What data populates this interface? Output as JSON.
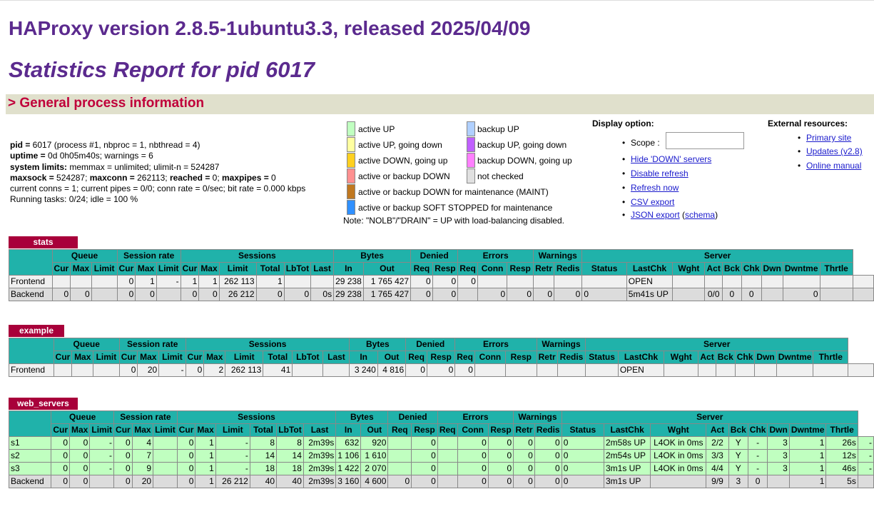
{
  "header": {
    "version_title": "HAProxy version 2.8.5-1ubuntu3.3, released 2025/04/09",
    "report_title": "Statistics Report for pid 6017",
    "section_title": "> General process information"
  },
  "process_info": {
    "line1_k": "pid =",
    "line1_v": " 6017 (process #1, nbproc = 1, nbthread = 4)",
    "line2_k": "uptime =",
    "line2_v": " 0d 0h05m40s; warnings = 6",
    "line3_k": "system limits:",
    "line3_v": " memmax = unlimited; ulimit-n = 524287",
    "line4_k1": "maxsock =",
    "line4_v1": " 524287; ",
    "line4_k2": "maxconn =",
    "line4_v2": " 262113; ",
    "line4_k3": "reached =",
    "line4_v3": " 0; ",
    "line4_k4": "maxpipes =",
    "line4_v4": " 0",
    "line5": "current conns = 1; current pipes = 0/0; conn rate = 0/sec; bit rate = 0.000 kbps",
    "line6": "Running tasks: 0/24; idle = 100 %"
  },
  "legend": {
    "active_up": "active UP",
    "active_up_going_down": "active UP, going down",
    "active_down_going_up": "active DOWN, going up",
    "active_or_backup_down": "active or backup DOWN",
    "maint": "active or backup DOWN for maintenance (MAINT)",
    "soft_stopped": "active or backup SOFT STOPPED for maintenance",
    "backup_up": "backup UP",
    "backup_up_going_down": "backup UP, going down",
    "backup_down_going_up": "backup DOWN, going up",
    "not_checked": "not checked",
    "note": "Note: \"NOLB\"/\"DRAIN\" = UP with load-balancing disabled.",
    "colors": {
      "active_up": "#c0ffc0",
      "active_up_going_down": "#ffffa0",
      "active_down_going_up": "#ffd020",
      "active_or_backup_down": "#ff9090",
      "maint": "#c07820",
      "soft_stopped": "#3090ff",
      "backup_up": "#b0d0ff",
      "backup_up_going_down": "#c060ff",
      "backup_down_going_up": "#ff80ff",
      "not_checked": "#e0e0e0"
    }
  },
  "display_option": {
    "title": "Display option:",
    "scope_label": "Scope :",
    "hide_down": "Hide 'DOWN' servers",
    "disable_refresh": "Disable refresh",
    "refresh_now": "Refresh now",
    "csv_export": "CSV export",
    "json_export": "JSON export",
    "schema_open": " (",
    "schema": "schema",
    "schema_close": ")"
  },
  "external": {
    "title": "External resources:",
    "primary_site": "Primary site",
    "updates": "Updates (v2.8)",
    "online_manual": "Online manual"
  },
  "headers": {
    "queue": "Queue",
    "session_rate": "Session rate",
    "sessions": "Sessions",
    "bytes": "Bytes",
    "denied": "Denied",
    "errors": "Errors",
    "warnings": "Warnings",
    "server": "Server",
    "cur": "Cur",
    "max": "Max",
    "limit": "Limit",
    "total": "Total",
    "lbtot": "LbTot",
    "last": "Last",
    "in": "In",
    "out": "Out",
    "req": "Req",
    "resp": "Resp",
    "conn": "Conn",
    "retr": "Retr",
    "redis": "Redis",
    "status": "Status",
    "lastchk": "LastChk",
    "wght": "Wght",
    "act": "Act",
    "bck": "Bck",
    "chk": "Chk",
    "dwn": "Dwn",
    "dwntme": "Dwntme",
    "thrtle": "Thrtle"
  },
  "tables": [
    {
      "name": "stats",
      "rows": [
        [
          "Frontend",
          "",
          "",
          "",
          "0",
          "1",
          "-",
          "1",
          "1",
          "262 113",
          "1",
          "",
          "",
          "29 238",
          "1 765 427",
          "0",
          "0",
          "0",
          "",
          "",
          "",
          "",
          "",
          "OPEN",
          "",
          "",
          "",
          "",
          "",
          "",
          "",
          ""
        ],
        [
          "Backend",
          "0",
          "0",
          "",
          "0",
          "0",
          "",
          "0",
          "0",
          "26 212",
          "0",
          "0",
          "0s",
          "29 238",
          "1 765 427",
          "0",
          "0",
          "",
          "0",
          "0",
          "0",
          "0",
          "0",
          "5m41s UP",
          "",
          "0/0",
          "0",
          "0",
          "",
          "0",
          "",
          ""
        ]
      ]
    },
    {
      "name": "example",
      "rows": [
        [
          "Frontend",
          "",
          "",
          "",
          "0",
          "20",
          "-",
          "0",
          "2",
          "262 113",
          "41",
          "",
          "",
          "3 240",
          "4 816",
          "0",
          "0",
          "0",
          "",
          "",
          "",
          "",
          "",
          "OPEN",
          "",
          "",
          "",
          "",
          "",
          "",
          "",
          ""
        ]
      ]
    },
    {
      "name": "web_servers",
      "rows": [
        [
          "s1",
          "0",
          "0",
          "-",
          "0",
          "4",
          "",
          "0",
          "1",
          "-",
          "8",
          "8",
          "2m39s",
          "632",
          "920",
          "",
          "0",
          "",
          "0",
          "0",
          "0",
          "0",
          "0",
          "2m58s UP",
          "L4OK in 0ms",
          "2/2",
          "Y",
          "-",
          "3",
          "1",
          "26s",
          "-"
        ],
        [
          "s2",
          "0",
          "0",
          "-",
          "0",
          "7",
          "",
          "0",
          "1",
          "-",
          "14",
          "14",
          "2m39s",
          "1 106",
          "1 610",
          "",
          "0",
          "",
          "0",
          "0",
          "0",
          "0",
          "0",
          "2m54s UP",
          "L4OK in 0ms",
          "3/3",
          "Y",
          "-",
          "3",
          "1",
          "12s",
          "-"
        ],
        [
          "s3",
          "0",
          "0",
          "-",
          "0",
          "9",
          "",
          "0",
          "1",
          "-",
          "18",
          "18",
          "2m39s",
          "1 422",
          "2 070",
          "",
          "0",
          "",
          "0",
          "0",
          "0",
          "0",
          "0",
          "3m1s UP",
          "L4OK in 0ms",
          "4/4",
          "Y",
          "-",
          "3",
          "1",
          "46s",
          "-"
        ],
        [
          "Backend",
          "0",
          "0",
          "",
          "0",
          "20",
          "",
          "0",
          "1",
          "26 212",
          "40",
          "40",
          "2m39s",
          "3 160",
          "4 600",
          "0",
          "0",
          "",
          "0",
          "0",
          "0",
          "0",
          "0",
          "3m1s UP",
          "",
          "9/9",
          "3",
          "0",
          "",
          "1",
          "5s",
          ""
        ]
      ]
    }
  ]
}
